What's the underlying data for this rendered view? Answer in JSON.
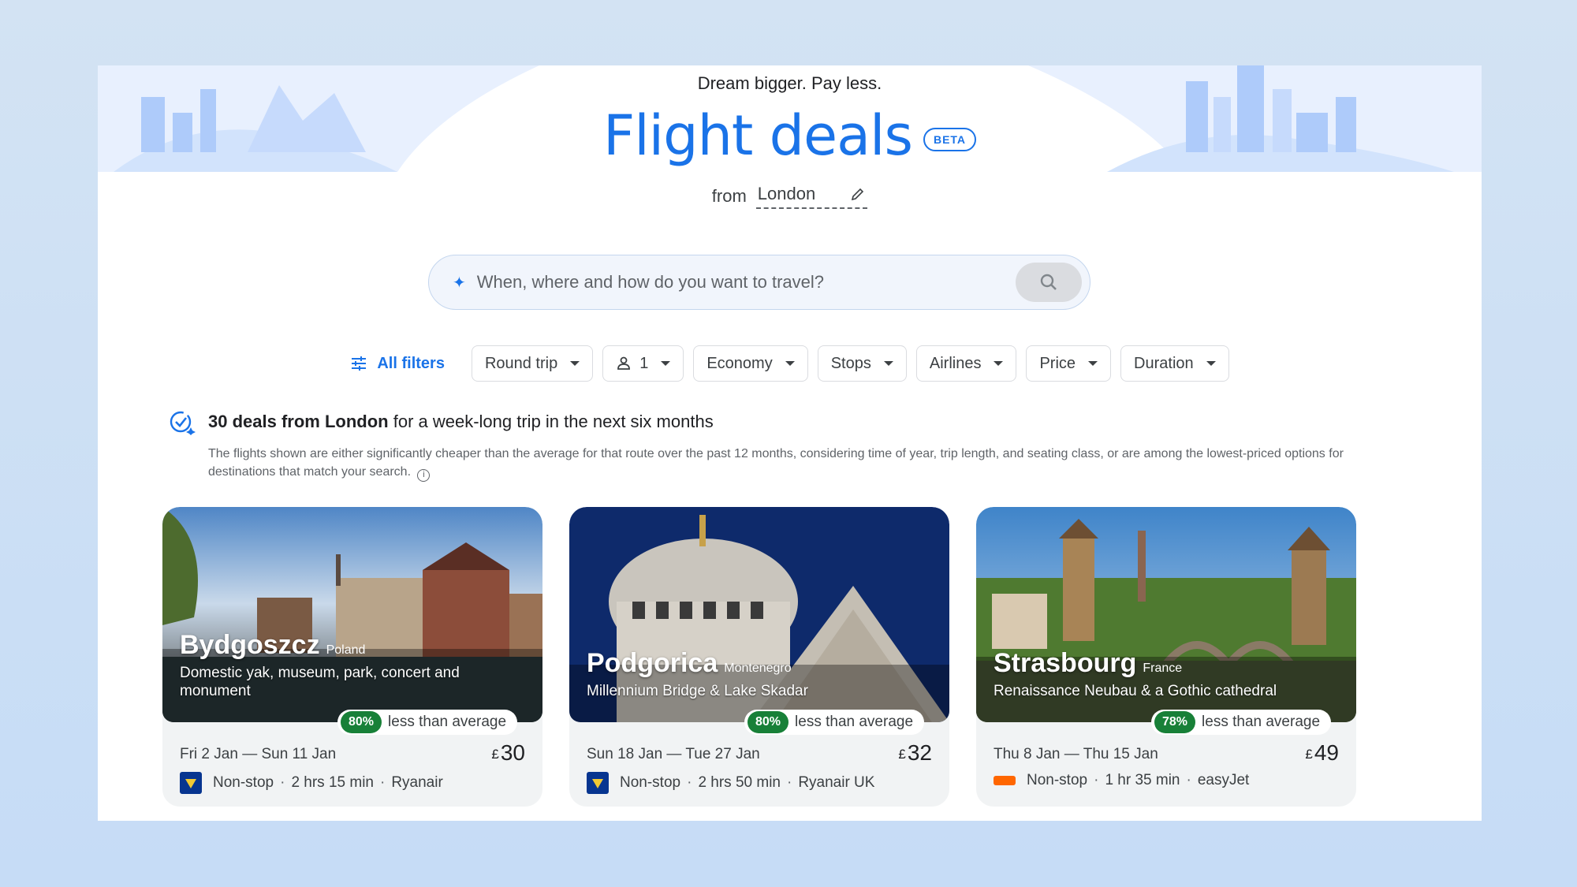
{
  "header": {
    "tagline": "Dream bigger. Pay less.",
    "title": "Flight deals",
    "beta_label": "BETA",
    "from_label": "from",
    "from_value": "London"
  },
  "search": {
    "placeholder": "When, where and how do you want to travel?"
  },
  "filters": {
    "all_filters": "All filters",
    "trip_type": "Round trip",
    "passengers": "1",
    "cabin": "Economy",
    "stops": "Stops",
    "airlines": "Airlines",
    "price": "Price",
    "duration": "Duration"
  },
  "summary": {
    "bold": "30 deals from London",
    "rest": "for a week-long trip in the next six months",
    "note": "The flights shown are either significantly cheaper than the average for that route over the past 12 months, considering time of year, trip length, and seating class, or are among the lowest-priced options for destinations that match your search."
  },
  "deals": [
    {
      "city": "Bydgoszcz",
      "country": "Poland",
      "description": "Domestic yak, museum, park, concert and monument",
      "discount": "80%",
      "discount_label": "less than average",
      "dates": "Fri 2 Jan — Sun 11 Jan",
      "currency": "£",
      "price": "30",
      "stops": "Non-stop",
      "duration": "2 hrs 15 min",
      "airline": "Ryanair",
      "airline_logo": "ryanair-logo"
    },
    {
      "city": "Podgorica",
      "country": "Montenegro",
      "description": "Millennium Bridge & Lake Skadar",
      "discount": "80%",
      "discount_label": "less than average",
      "dates": "Sun 18 Jan — Tue 27 Jan",
      "currency": "£",
      "price": "32",
      "stops": "Non-stop",
      "duration": "2 hrs 50 min",
      "airline": "Ryanair UK",
      "airline_logo": "ryanair-logo"
    },
    {
      "city": "Strasbourg",
      "country": "France",
      "description": "Renaissance Neubau & a Gothic cathedral",
      "discount": "78%",
      "discount_label": "less than average",
      "dates": "Thu 8 Jan — Thu 15 Jan",
      "currency": "£",
      "price": "49",
      "stops": "Non-stop",
      "duration": "1 hr 35 min",
      "airline": "easyJet",
      "airline_logo": "easyjet-logo"
    }
  ],
  "colors": {
    "accent": "#1a73e8",
    "deal_green": "#188038",
    "page_bg": "#c6dcf6"
  }
}
